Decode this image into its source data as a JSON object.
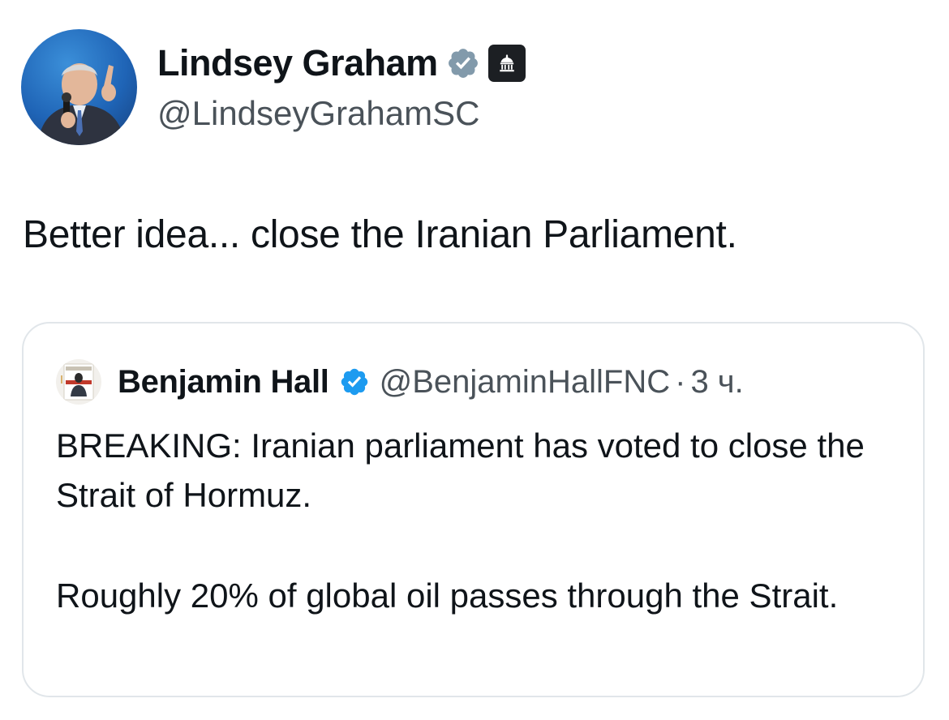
{
  "post": {
    "author": {
      "display_name": "Lindsey Graham",
      "handle": "@LindseyGrahamSC",
      "verified_badge_icon": "verified-badge-icon",
      "affiliation_icon": "government-building-icon"
    },
    "text": "Better idea... close the Iranian Parliament."
  },
  "quoted_post": {
    "author": {
      "display_name": "Benjamin Hall",
      "handle": "@BenjaminHallFNC",
      "verified_badge_icon": "verified-badge-icon"
    },
    "separator": "·",
    "time": "3 ч.",
    "paragraphs": [
      "BREAKING: Iranian parliament has voted to close the Strait of Hormuz.",
      "Roughly 20% of global oil passes through the Strait."
    ]
  },
  "colors": {
    "text": "#0f1419",
    "secondary_text": "#4a5259",
    "card_border": "#e1e6ea",
    "gray_badge": "#829aab",
    "blue_badge": "#1d9bf0",
    "gov_badge_bg": "#1c1f23"
  }
}
